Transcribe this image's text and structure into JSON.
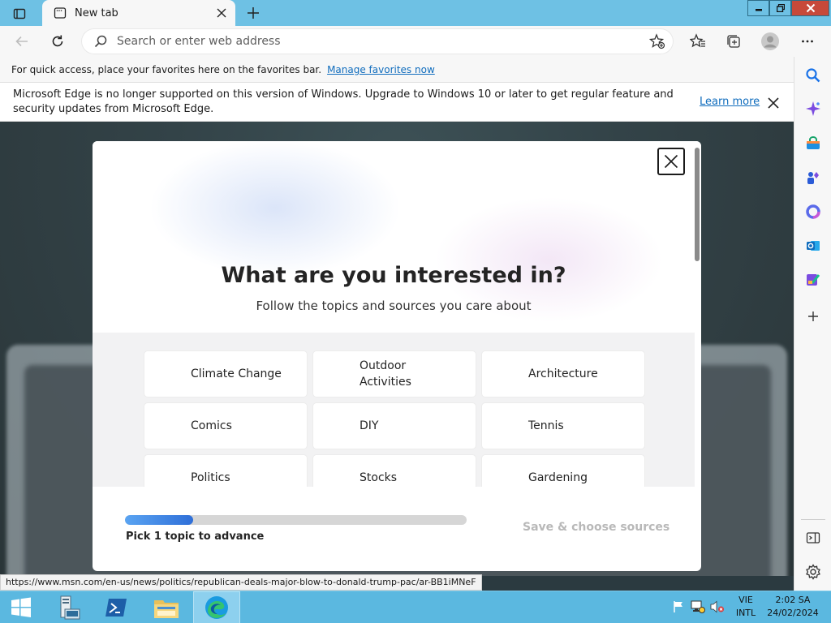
{
  "browser": {
    "tab_title": "New tab",
    "address_placeholder": "Search or enter web address"
  },
  "favorites_bar": {
    "message": "For quick access, place your favorites here on the favorites bar.",
    "link": "Manage favorites now"
  },
  "info_bar": {
    "message": "Microsoft Edge is no longer supported on this version of Windows. Upgrade to Windows 10 or later to get regular feature and security updates from Microsoft Edge.",
    "link": "Learn more"
  },
  "modal": {
    "title": "What are you interested in?",
    "subtitle": "Follow the topics and sources you care about",
    "topics": [
      [
        "Climate Change",
        "Outdoor Activities",
        "Architecture"
      ],
      [
        "Comics",
        "DIY",
        "Tennis"
      ],
      [
        "Politics",
        "Stocks",
        "Gardening"
      ]
    ],
    "progress_fraction": 0.2,
    "hint": "Pick 1 topic to advance",
    "save_label": "Save & choose sources"
  },
  "status_url": "https://www.msn.com/en-us/news/politics/republican-deals-major-blow-to-donald-trump-pac/ar-BB1iMNeF",
  "taskbar": {
    "language_line1": "VIE",
    "language_line2": "INTL",
    "time": "2:02 SA",
    "date": "24/02/2024"
  },
  "colors": {
    "titlebar": "#6ec1e4",
    "taskbar": "#5bb8e0",
    "link": "#0f6cbd",
    "close_button": "#c7493a"
  },
  "icons": {
    "tab_actions": "tab-actions-icon",
    "sidebar": [
      "search-icon",
      "copilot-icon",
      "shopping-icon",
      "games-icon",
      "microsoft365-icon",
      "outlook-icon",
      "designer-icon",
      "add-icon",
      "hide-sidebar-icon",
      "settings-icon"
    ]
  }
}
